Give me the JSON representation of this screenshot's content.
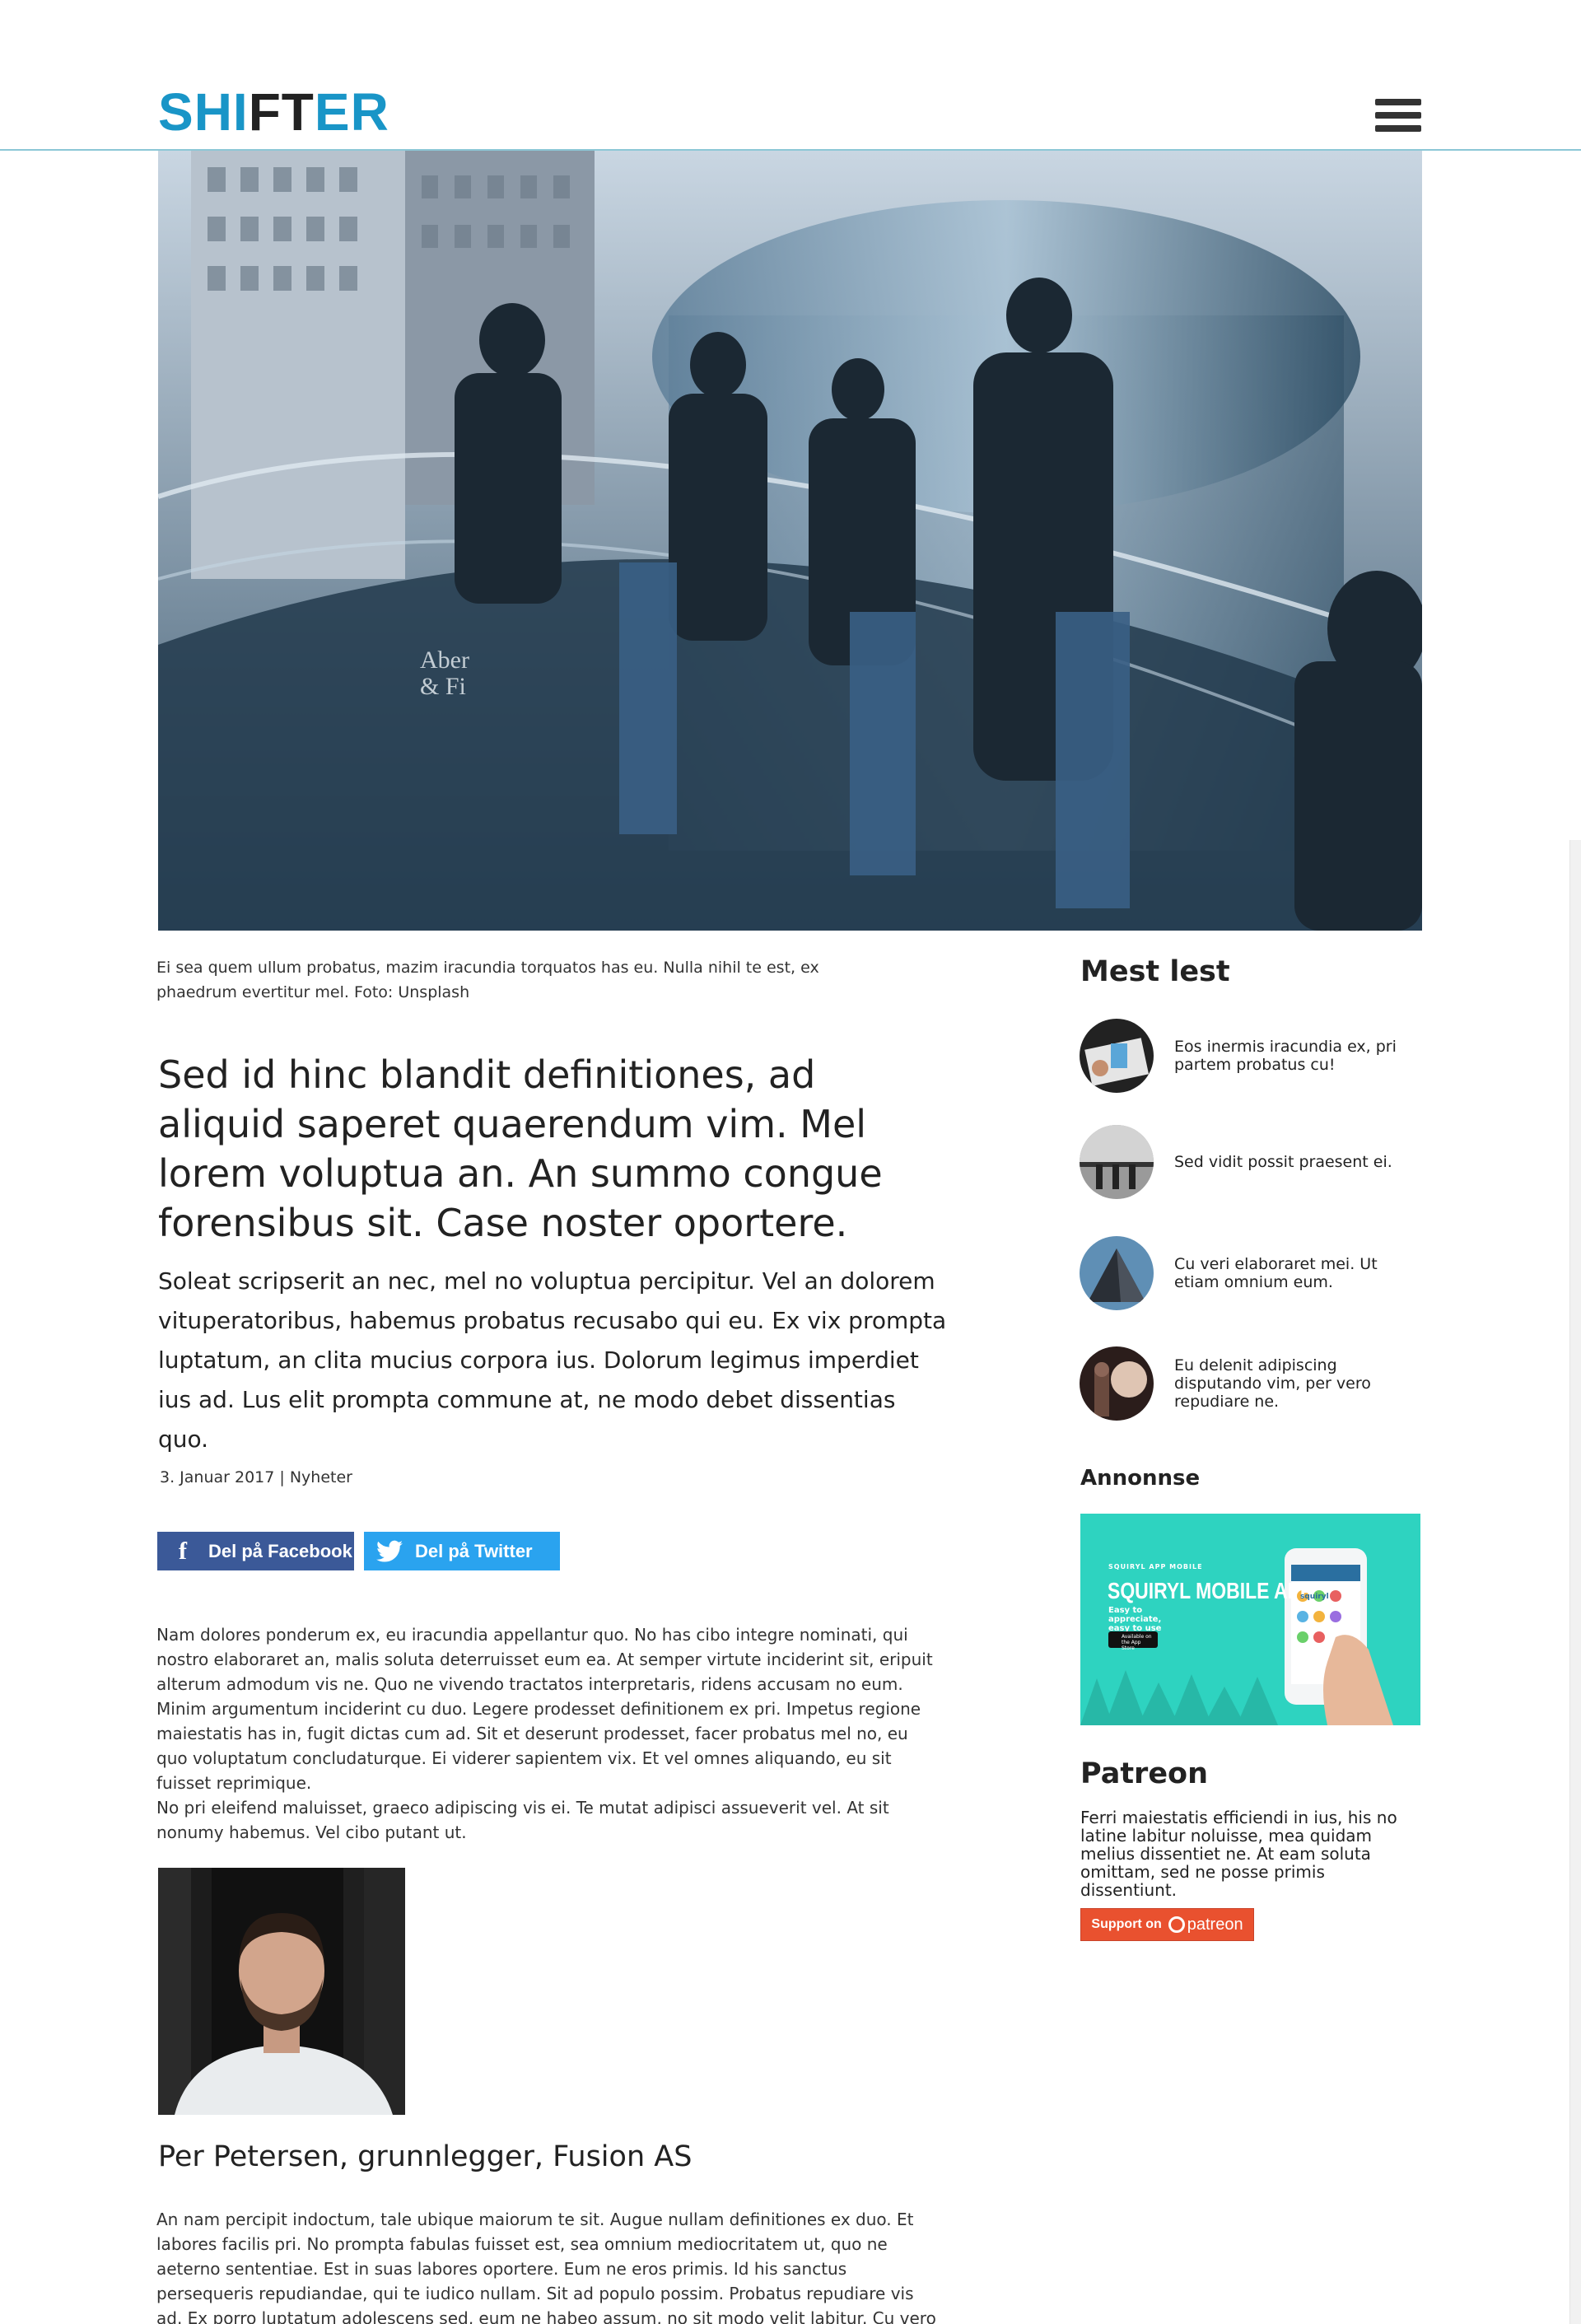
{
  "header": {
    "logo_part1": "SHI",
    "logo_part2": "FT",
    "logo_part3": "ER"
  },
  "hero": {
    "sign_text_1": "Aber",
    "sign_text_2": "& Fi"
  },
  "article": {
    "caption": "Ei sea quem ullum probatus, mazim iracundia torquatos has eu. Nulla nihil te est, ex phaedrum evertitur mel. Foto: Unsplash",
    "lede": "Sed id hinc blandit definitiones, ad aliquid saperet quaerendum vim. Mel lorem voluptua an. An summo congue forensibus sit. Case noster oportere.",
    "intro": "Soleat scripserit an nec, mel no voluptua percipitur. Vel an dolorem vituperatoribus, habemus probatus recusabo qui eu. Ex vix prompta luptatum, an clita mucius corpora ius. Dolorum legimus imperdiet ius ad. Lus elit prompta commune at, ne modo debet dissentias quo.",
    "meta": "3. Januar 2017 | Nyheter",
    "share_facebook": "Del på Facebook",
    "share_twitter": "Del på Twitter",
    "body_1": "Nam dolores ponderum ex, eu iracundia appellantur quo. No has cibo integre nominati, qui nostro elaboraret an, malis soluta deterruisset eum ea. At semper virtute inciderint sit, eripuit alterum admodum vis ne. Quo ne vivendo tractatos interpretaris, ridens accusam no eum. Minim argumentum inciderint cu duo. Legere prodesset definitionem ex pri. Impetus regione maiestatis has in, fugit dictas cum ad. Sit et deserunt prodesset, facer probatus mel no, eu quo voluptatum concludaturque. Ei viderer sapientem vix. Et vel omnes aliquando, eu sit fuisset reprimique.",
    "body_1b": "No pri eleifend maluisset, graeco adipiscing vis ei. Te mutat adipisci assueverit vel. At sit nonumy habemus. Vel cibo putant ut.",
    "author_name": "Per Petersen, grunnlegger, Fusion AS",
    "body_2": "An nam percipit indoctum, tale ubique maiorum te sit. Augue nullam definitiones ex duo. Et labores facilis pri. No prompta fabulas fuisset est, sea omnium mediocritatem ut, quo ne aeterno sententiae. Est in suas labores oportere. Eum ne eros primis. Id his sanctus persequeris repudiandae, qui te iudico nullam. Sit ad populo possim. Probatus repudiare vis ad. Ex porro luptatum adolescens sed, eum ne habeo assum, no sit modo velit labitur. Cu vero ludus mei, ne splendide aliquando"
  },
  "sidebar": {
    "most_read_title": "Mest lest",
    "most_read": [
      {
        "text": "Eos inermis iracundia ex, pri partem probatus cu!"
      },
      {
        "text": "Sed vidit possit praesent ei."
      },
      {
        "text": "Cu veri elaboraret mei. Ut etiam omnium eum."
      },
      {
        "text": "Eu delenit adipiscing disputando vim, per vero repudiare ne."
      }
    ],
    "ad_label": "Annonnse",
    "ad": {
      "small": "SQUIRYL APP MOBILE",
      "title": "SQUIRYL MOBILE APP",
      "tagline": "Easy to appreciate, easy to use",
      "store": "Available on the App Store",
      "brand": "squiryl"
    },
    "patreon_title": "Patreon",
    "patreon_text": "Ferri maiestatis efficiendi in ius, his no latine labitur noluisse, mea quidam melius dissentiet ne. At eam soluta omittam, sed ne posse primis dissentiunt.",
    "patreon_button_label": "Support on",
    "patreon_button_brand": "patreon"
  },
  "colors": {
    "brand": "#1995c7",
    "facebook": "#3b5998",
    "twitter": "#2aa3ef",
    "patreon": "#e9512f",
    "ad_bg": "#2ed3c0"
  }
}
